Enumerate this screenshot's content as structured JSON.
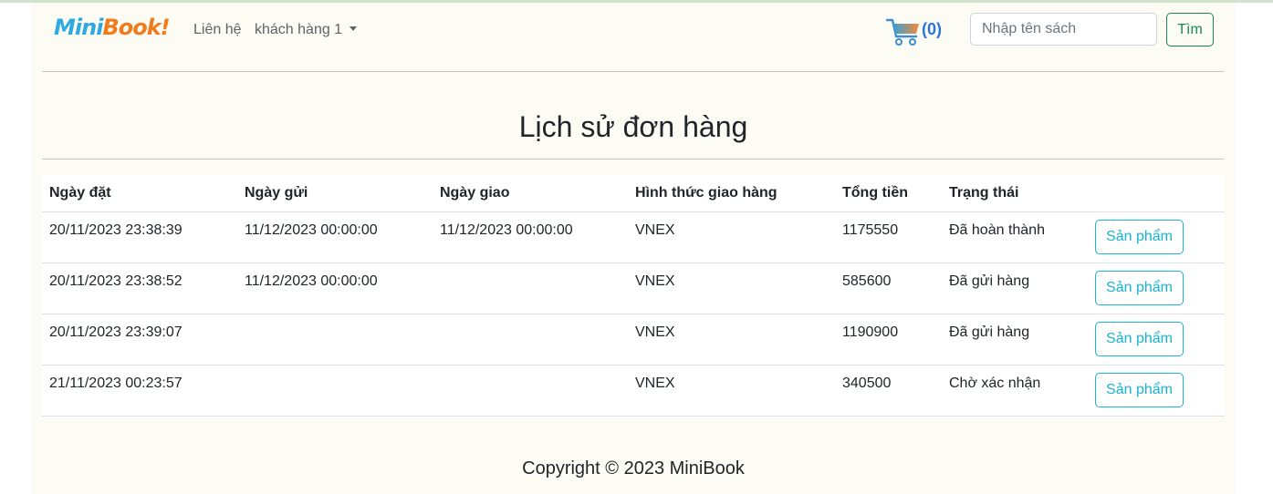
{
  "brand": {
    "part1": "Mini",
    "part2": "Book!"
  },
  "nav": {
    "contact": "Liên hệ",
    "user": "khách hàng 1"
  },
  "cart": {
    "count": "(0)"
  },
  "search": {
    "placeholder": "Nhập tên sách",
    "button": "Tìm"
  },
  "page_title": "Lịch sử đơn hàng",
  "table": {
    "headers": [
      "Ngày đặt",
      "Ngày gửi",
      "Ngày giao",
      "Hình thức giao hàng",
      "Tổng tiền",
      "Trạng thái",
      ""
    ],
    "rows": [
      {
        "order_date": "20/11/2023 23:38:39",
        "sent_date": "11/12/2023 00:00:00",
        "delivered_date": "11/12/2023 00:00:00",
        "shipping": "VNEX",
        "total": "1175550",
        "status": "Đã hoàn thành",
        "action": "Sản phẩm"
      },
      {
        "order_date": "20/11/2023 23:38:52",
        "sent_date": "11/12/2023 00:00:00",
        "delivered_date": "",
        "shipping": "VNEX",
        "total": "585600",
        "status": "Đã gửi hàng",
        "action": "Sản phẩm"
      },
      {
        "order_date": "20/11/2023 23:39:07",
        "sent_date": "",
        "delivered_date": "",
        "shipping": "VNEX",
        "total": "1190900",
        "status": "Đã gửi hàng",
        "action": "Sản phẩm"
      },
      {
        "order_date": "21/11/2023 00:23:57",
        "sent_date": "",
        "delivered_date": "",
        "shipping": "VNEX",
        "total": "340500",
        "status": "Chờ xác nhận",
        "action": "Sản phẩm"
      }
    ]
  },
  "footer": "Copyright © 2023 MiniBook",
  "icons": {
    "cart": "shopping-cart-icon",
    "dropdown": "caret-down-icon"
  },
  "colors": {
    "accent_blue": "#2a74d8",
    "brand_blue": "#2ea9e1",
    "brand_orange": "#f07c1e",
    "search_green": "#198754",
    "product_cyan": "#1ab3cf",
    "page_bg": "#fcfcf5"
  }
}
